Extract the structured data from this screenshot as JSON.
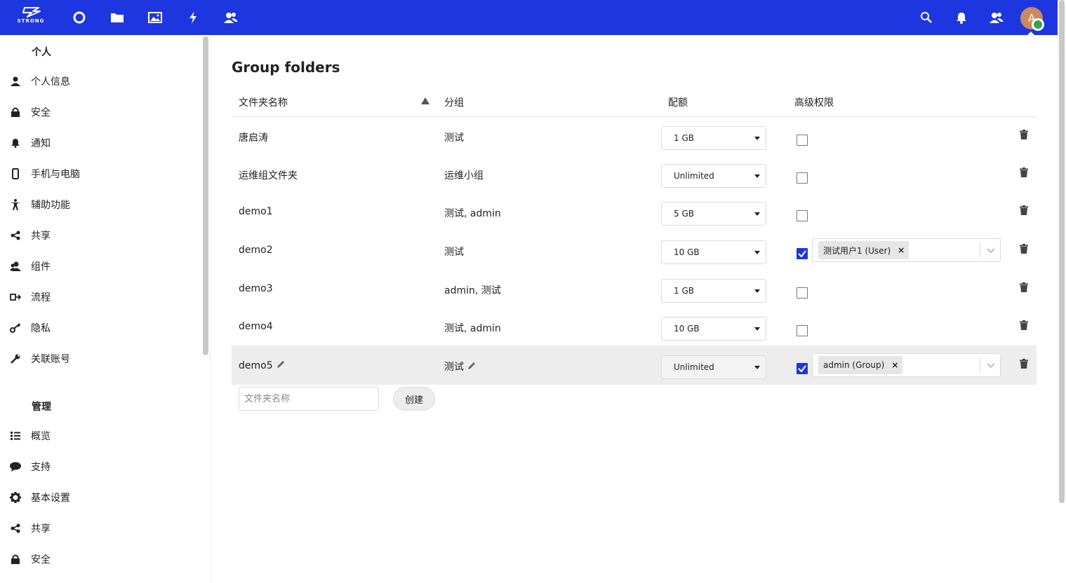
{
  "header": {
    "logo_text": "STRONG",
    "avatar_letter": "A",
    "colors": {
      "header_bg": "#1d36e0",
      "accent": "#1d36e0",
      "status_online": "#3aa14e"
    },
    "app_icons": [
      "dashboard-icon",
      "files-icon",
      "photos-icon",
      "activity-icon",
      "contacts-icon"
    ],
    "right_icons": [
      "search-icon",
      "notifications-icon",
      "contacts-menu-icon"
    ]
  },
  "sidebar": {
    "personal_heading": "个人",
    "personal_items": [
      {
        "label": "个人信息",
        "icon": "person-icon"
      },
      {
        "label": "安全",
        "icon": "lock-icon"
      },
      {
        "label": "通知",
        "icon": "bell-icon"
      },
      {
        "label": "手机与电脑",
        "icon": "phone-icon"
      },
      {
        "label": "辅助功能",
        "icon": "accessibility-icon"
      },
      {
        "label": "共享",
        "icon": "share-icon"
      },
      {
        "label": "组件",
        "icon": "group-icon"
      },
      {
        "label": "流程",
        "icon": "flow-icon"
      },
      {
        "label": "隐私",
        "icon": "key-icon"
      },
      {
        "label": "关联账号",
        "icon": "wrench-icon"
      }
    ],
    "admin_heading": "管理",
    "admin_items": [
      {
        "label": "概览",
        "icon": "list-icon"
      },
      {
        "label": "支持",
        "icon": "chat-icon"
      },
      {
        "label": "基本设置",
        "icon": "gear-icon"
      },
      {
        "label": "共享",
        "icon": "share-icon"
      },
      {
        "label": "安全",
        "icon": "lock-icon"
      }
    ]
  },
  "main": {
    "title": "Group folders",
    "columns": {
      "name": "文件夹名称",
      "groups": "分组",
      "quota": "配额",
      "acl": "高级权限"
    },
    "rows": [
      {
        "name": "唐启涛",
        "groups": "测试",
        "quota": "1 GB",
        "acl": false
      },
      {
        "name": "运维组文件夹",
        "groups": "运维小组",
        "quota": "Unlimited",
        "acl": false
      },
      {
        "name": "demo1",
        "groups": "测试, admin",
        "quota": "5 GB",
        "acl": false
      },
      {
        "name": "demo2",
        "groups": "测试",
        "quota": "10 GB",
        "acl": true,
        "acl_tag": "测试用户1 (User)"
      },
      {
        "name": "demo3",
        "groups": "admin, 测试",
        "quota": "1 GB",
        "acl": false
      },
      {
        "name": "demo4",
        "groups": "测试, admin",
        "quota": "10 GB",
        "acl": false
      },
      {
        "name": "demo5",
        "groups": "测试",
        "quota": "Unlimited",
        "acl": true,
        "acl_tag": "admin (Group)"
      }
    ],
    "new_folder_placeholder": "文件夹名称",
    "create_label": "创建"
  }
}
